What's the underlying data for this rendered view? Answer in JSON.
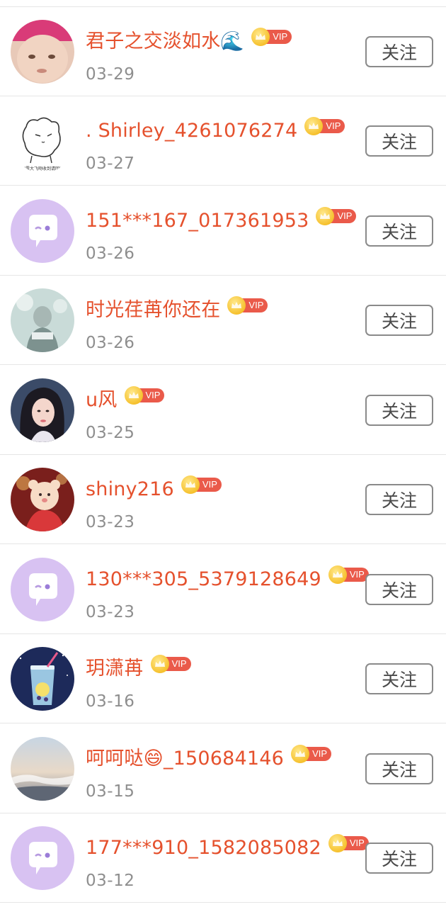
{
  "follow_label": "关注",
  "vip_label": "VIP",
  "users": [
    {
      "name": "君子之交淡如水🌊",
      "date": "03-29",
      "avatar": "photo-baby"
    },
    {
      "name": ". Shirley_4261076274",
      "date": "03-27",
      "avatar": "sketch-cat",
      "avatar_caption": "\"露大飞吻收到请回\""
    },
    {
      "name": "151***167_017361953",
      "date": "03-26",
      "avatar": "default-chat"
    },
    {
      "name": "时光荏苒你还在",
      "date": "03-26",
      "avatar": "photo-misty"
    },
    {
      "name": "u风",
      "date": "03-25",
      "avatar": "photo-girl"
    },
    {
      "name": "shiny216",
      "date": "03-23",
      "avatar": "photo-bear"
    },
    {
      "name": "130***305_5379128649",
      "date": "03-23",
      "avatar": "default-chat"
    },
    {
      "name": "玥潇苒",
      "date": "03-16",
      "avatar": "photo-drink"
    },
    {
      "name": "呵呵哒😄_150684146",
      "date": "03-15",
      "avatar": "photo-sky"
    },
    {
      "name": "177***910_1582085082",
      "date": "03-12",
      "avatar": "default-chat"
    }
  ],
  "colors": {
    "name": "#e5512d",
    "date": "#8e8e8e",
    "vip_tag": "#ea5a4a",
    "crown": "#f6c12e",
    "default_avatar_bg": "#d8c2f2",
    "divider": "#e6e6e6"
  }
}
